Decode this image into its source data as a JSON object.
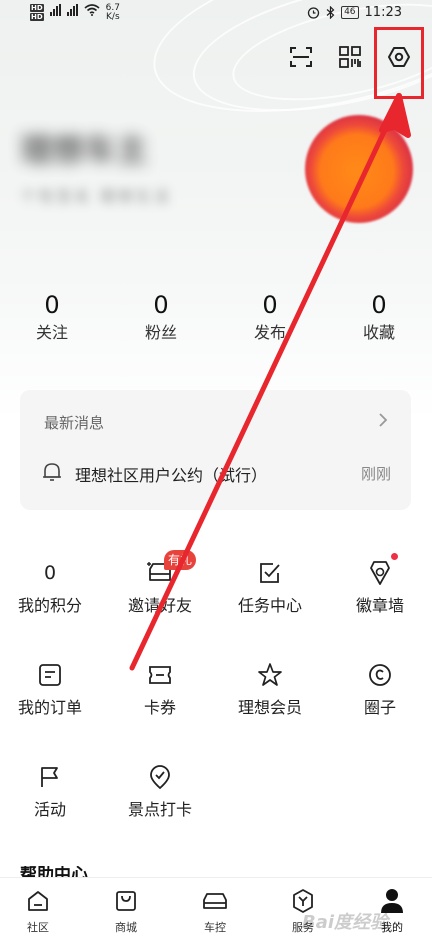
{
  "status_bar": {
    "net_speed": "6.7",
    "net_speed_unit": "K/s",
    "battery": "46",
    "time": "11:23"
  },
  "header": {
    "icons": [
      "scan-icon",
      "qr-code-icon",
      "settings-icon"
    ]
  },
  "profile": {
    "username": "理想车主",
    "subtitle": "个性签名 理想生活"
  },
  "stats": [
    {
      "value": "0",
      "label": "关注"
    },
    {
      "value": "0",
      "label": "粉丝"
    },
    {
      "value": "0",
      "label": "发布"
    },
    {
      "value": "0",
      "label": "收藏"
    }
  ],
  "messages": {
    "title": "最新消息",
    "item_text": "理想社区用户公约（试行）",
    "item_time": "刚刚"
  },
  "grid": [
    {
      "label": "我的积分",
      "value": "0",
      "icon": "points-counter"
    },
    {
      "label": "邀请好友",
      "icon": "invite-car-icon",
      "badge": "有礼"
    },
    {
      "label": "任务中心",
      "icon": "task-check-icon"
    },
    {
      "label": "徽章墙",
      "icon": "badge-medal-icon"
    },
    {
      "label": "我的订单",
      "icon": "order-list-icon"
    },
    {
      "label": "卡券",
      "icon": "coupon-icon"
    },
    {
      "label": "理想会员",
      "icon": "member-star-icon"
    },
    {
      "label": "圈子",
      "icon": "circle-c-icon"
    },
    {
      "label": "活动",
      "icon": "flag-icon"
    },
    {
      "label": "景点打卡",
      "icon": "checkin-pin-icon"
    }
  ],
  "help_section_title": "帮助中心",
  "bottom_nav": [
    {
      "label": "社区",
      "icon": "home-icon"
    },
    {
      "label": "商城",
      "icon": "shopping-bag-icon"
    },
    {
      "label": "车控",
      "icon": "car-icon"
    },
    {
      "label": "服务",
      "icon": "service-icon"
    },
    {
      "label": "我的",
      "icon": "profile-icon",
      "active": true
    }
  ],
  "watermark": "Bai度经验",
  "colors": {
    "accent_red": "#e8262d",
    "badge_red": "#e8423c",
    "avatar_orange": "#ff7a1a",
    "avatar_crimson": "#c7204a"
  }
}
